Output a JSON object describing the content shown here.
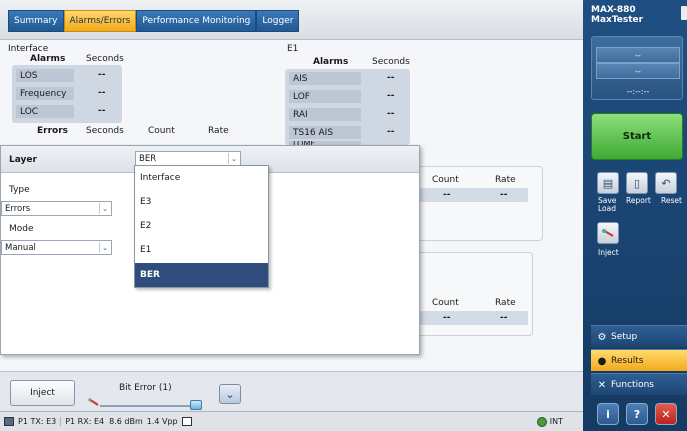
{
  "tabs": [
    "Summary",
    "Alarms/Errors",
    "Performance Monitoring",
    "Logger"
  ],
  "interface": {
    "title": "Interface",
    "alarms_header": "Alarms",
    "seconds_header": "Seconds",
    "alarms": [
      {
        "name": "LOS",
        "value": "--"
      },
      {
        "name": "Frequency",
        "value": "--"
      },
      {
        "name": "LOC",
        "value": "--"
      }
    ],
    "errors_header": "Errors",
    "err_seconds_header": "Seconds",
    "count_header": "Count",
    "rate_header": "Rate"
  },
  "e1": {
    "title": "E1",
    "alarms_header": "Alarms",
    "seconds_header": "Seconds",
    "alarms": [
      {
        "name": "AIS",
        "value": "--"
      },
      {
        "name": "LOF",
        "value": "--"
      },
      {
        "name": "RAI",
        "value": "--"
      },
      {
        "name": "TS16 AIS",
        "value": "--"
      }
    ],
    "partial_row": "LOMF"
  },
  "stats_panel1": {
    "count_header": "Count",
    "rate_header": "Rate",
    "count": "--",
    "rate": "--"
  },
  "stats_panel2": {
    "count_header": "Count",
    "rate_header": "Rate",
    "count": "--",
    "rate": "--"
  },
  "layer_dialog": {
    "layer_label": "Layer",
    "layer_value": "BER",
    "type_label": "Type",
    "type_value": "Errors",
    "mode_label": "Mode",
    "mode_value": "Manual",
    "options": [
      "Interface",
      "E3",
      "E2",
      "E1",
      "BER"
    ],
    "selected": "BER"
  },
  "bottom": {
    "inject_label": "Inject",
    "bit_error_label": "Bit Error (1)"
  },
  "status": {
    "tx": "P1 TX: E3",
    "rx": "P1 RX: E4",
    "power": "8.6 dBm",
    "vpp": "1.4 Vpp",
    "clock": "INT"
  },
  "sidebar": {
    "device_name": "MAX-880",
    "device_sub": "MaxTester",
    "timer_lines": [
      "--",
      "--",
      "--:--:--"
    ],
    "start_label": "Start",
    "save_load": "Save\nLoad",
    "report": "Report",
    "reset": "Reset",
    "inject": "Inject",
    "setup": "Setup",
    "results": "Results",
    "functions": "Functions"
  },
  "colors": {
    "accent": "#f3a91a",
    "sidebar": "#1f4f82",
    "start": "#3fa934",
    "selected": "#2e4d7c"
  }
}
